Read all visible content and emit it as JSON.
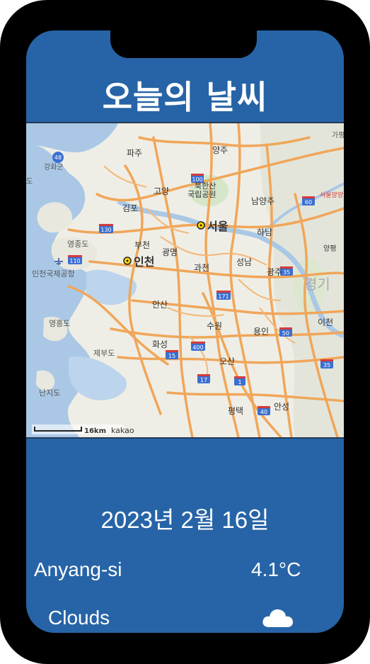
{
  "header": {
    "title": "오늘의 날씨"
  },
  "map": {
    "provider": "kakao",
    "scale_label": "16km",
    "places": {
      "paju": "파주",
      "yangju": "양주",
      "goyang": "고양",
      "bukhansan": "북한산",
      "national_park": "국립공원",
      "namyangju": "남양주",
      "gimpo": "김포",
      "seoul": "서울",
      "hanam": "하남",
      "bucheon": "부천",
      "incheon": "인천",
      "gwangmyeong": "광명",
      "gwacheon": "과천",
      "seongnam": "성남",
      "gwangju": "광주",
      "yangpyeong": "양평",
      "ansan": "안산",
      "suwon": "수원",
      "yongin": "용인",
      "icheon": "이천",
      "hwaseong": "화성",
      "osan": "오산",
      "pyeongtaek": "평택",
      "anseong": "안성",
      "gyeonggi": "경기",
      "ganghwagun": "강화군",
      "gapyeong": "가평",
      "yeongjongdo": "영종도",
      "incheon_airport": "인천국제공항",
      "yeongheungdo": "영흥도",
      "jebudo": "제부도",
      "nanjido": "난지도",
      "seoul_yangyang": "서울양양",
      "gyodo": "도"
    },
    "route_shields": [
      "48",
      "100",
      "60",
      "130",
      "110",
      "35",
      "171",
      "50",
      "400",
      "15",
      "35",
      "17",
      "1",
      "40"
    ]
  },
  "weather": {
    "date": "2023년 2월 16일",
    "city": "Anyang-si",
    "temperature": "4.1°C",
    "condition": "Clouds",
    "condition_icon": "cloud-icon"
  },
  "colors": {
    "screen": "#2764a7",
    "frame": "#000000",
    "road": "#f0a65a",
    "water": "#aac8e6"
  }
}
